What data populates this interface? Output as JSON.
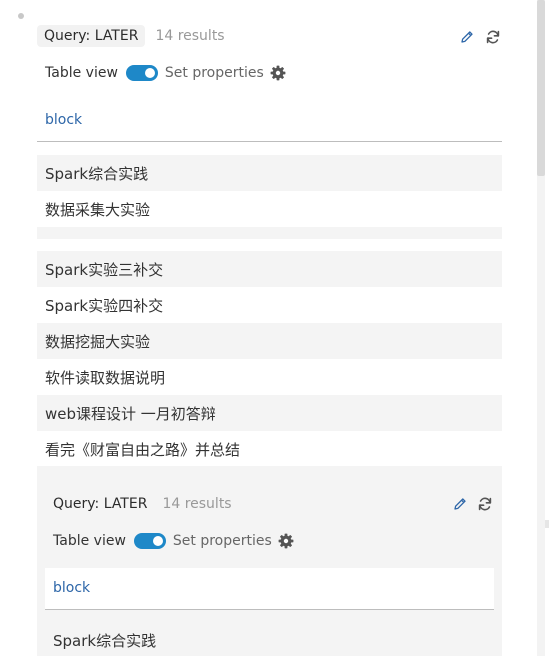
{
  "query": {
    "label": "Query: LATER",
    "count": "14 results",
    "table_view_label": "Table view",
    "table_view_on": true,
    "set_properties_label": "Set properties",
    "column_header": "block",
    "rows": [
      "Spark综合实践",
      "数据采集大实验",
      "",
      "Spark实验三补交",
      "Spark实验四补交",
      "数据挖掘大实验",
      "软件读取数据说明",
      "web课程设计 一月初答辩",
      "看完《财富自由之路》并总结"
    ]
  },
  "nested_query": {
    "label": "Query: LATER",
    "count": "14 results",
    "table_view_label": "Table view",
    "table_view_on": true,
    "set_properties_label": "Set properties",
    "column_header": "block",
    "rows": [
      "Spark综合实践"
    ]
  },
  "colors": {
    "accent": "#1e88c8",
    "link": "#2d66a8",
    "row_shade": "#f4f4f4"
  },
  "icons": [
    "edit-icon",
    "refresh-icon",
    "gear-icon"
  ]
}
